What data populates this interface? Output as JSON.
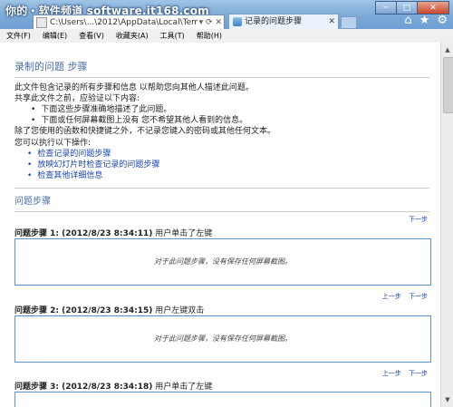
{
  "brand": "你的・软件频道 software.it168.com",
  "address": "C:\\Users\\...\\2012\\AppData\\Local\\Temp\\",
  "tab_title": "记录的问题步骤",
  "menu": [
    "文件(F)",
    "编辑(E)",
    "查看(V)",
    "收藏夹(A)",
    "工具(T)",
    "帮助(H)"
  ],
  "page": {
    "title": "录制的问题 步骤",
    "intro": [
      "此文件包含记录的所有步骤和信息 以帮助您向其他人描述此问题。",
      "共享此文件之前，应验证以下内容:"
    ],
    "checks": [
      "下面这些步骤准确地描述了此问题。",
      "下面或任何屏幕截图上没有 您不希望其他人看到的信息。"
    ],
    "privacy_note": "除了您使用的函数和快捷键之外，不记录您键入的密码或其他任何文本。",
    "actions_label": "您可以执行以下操作:",
    "actions": [
      "检查记录的问题步骤",
      "放映幻灯片时检查记录的问题步骤",
      "检查其他详细信息"
    ],
    "steps_heading": "问题步骤",
    "nav_next": "下一步",
    "nav_prev": "上一步",
    "no_screenshot": "对于此问题步骤，没有保存任何屏幕截图。",
    "steps": [
      {
        "label": "问题步骤 1: (2012/8/23 8:34:11)",
        "action": "用户单击了左键"
      },
      {
        "label": "问题步骤 2: (2012/8/23 8:34:15)",
        "action": "用户左键双击"
      },
      {
        "label": "问题步骤 3: (2012/8/23 8:34:18)",
        "action": "用户单击了左键"
      }
    ]
  }
}
